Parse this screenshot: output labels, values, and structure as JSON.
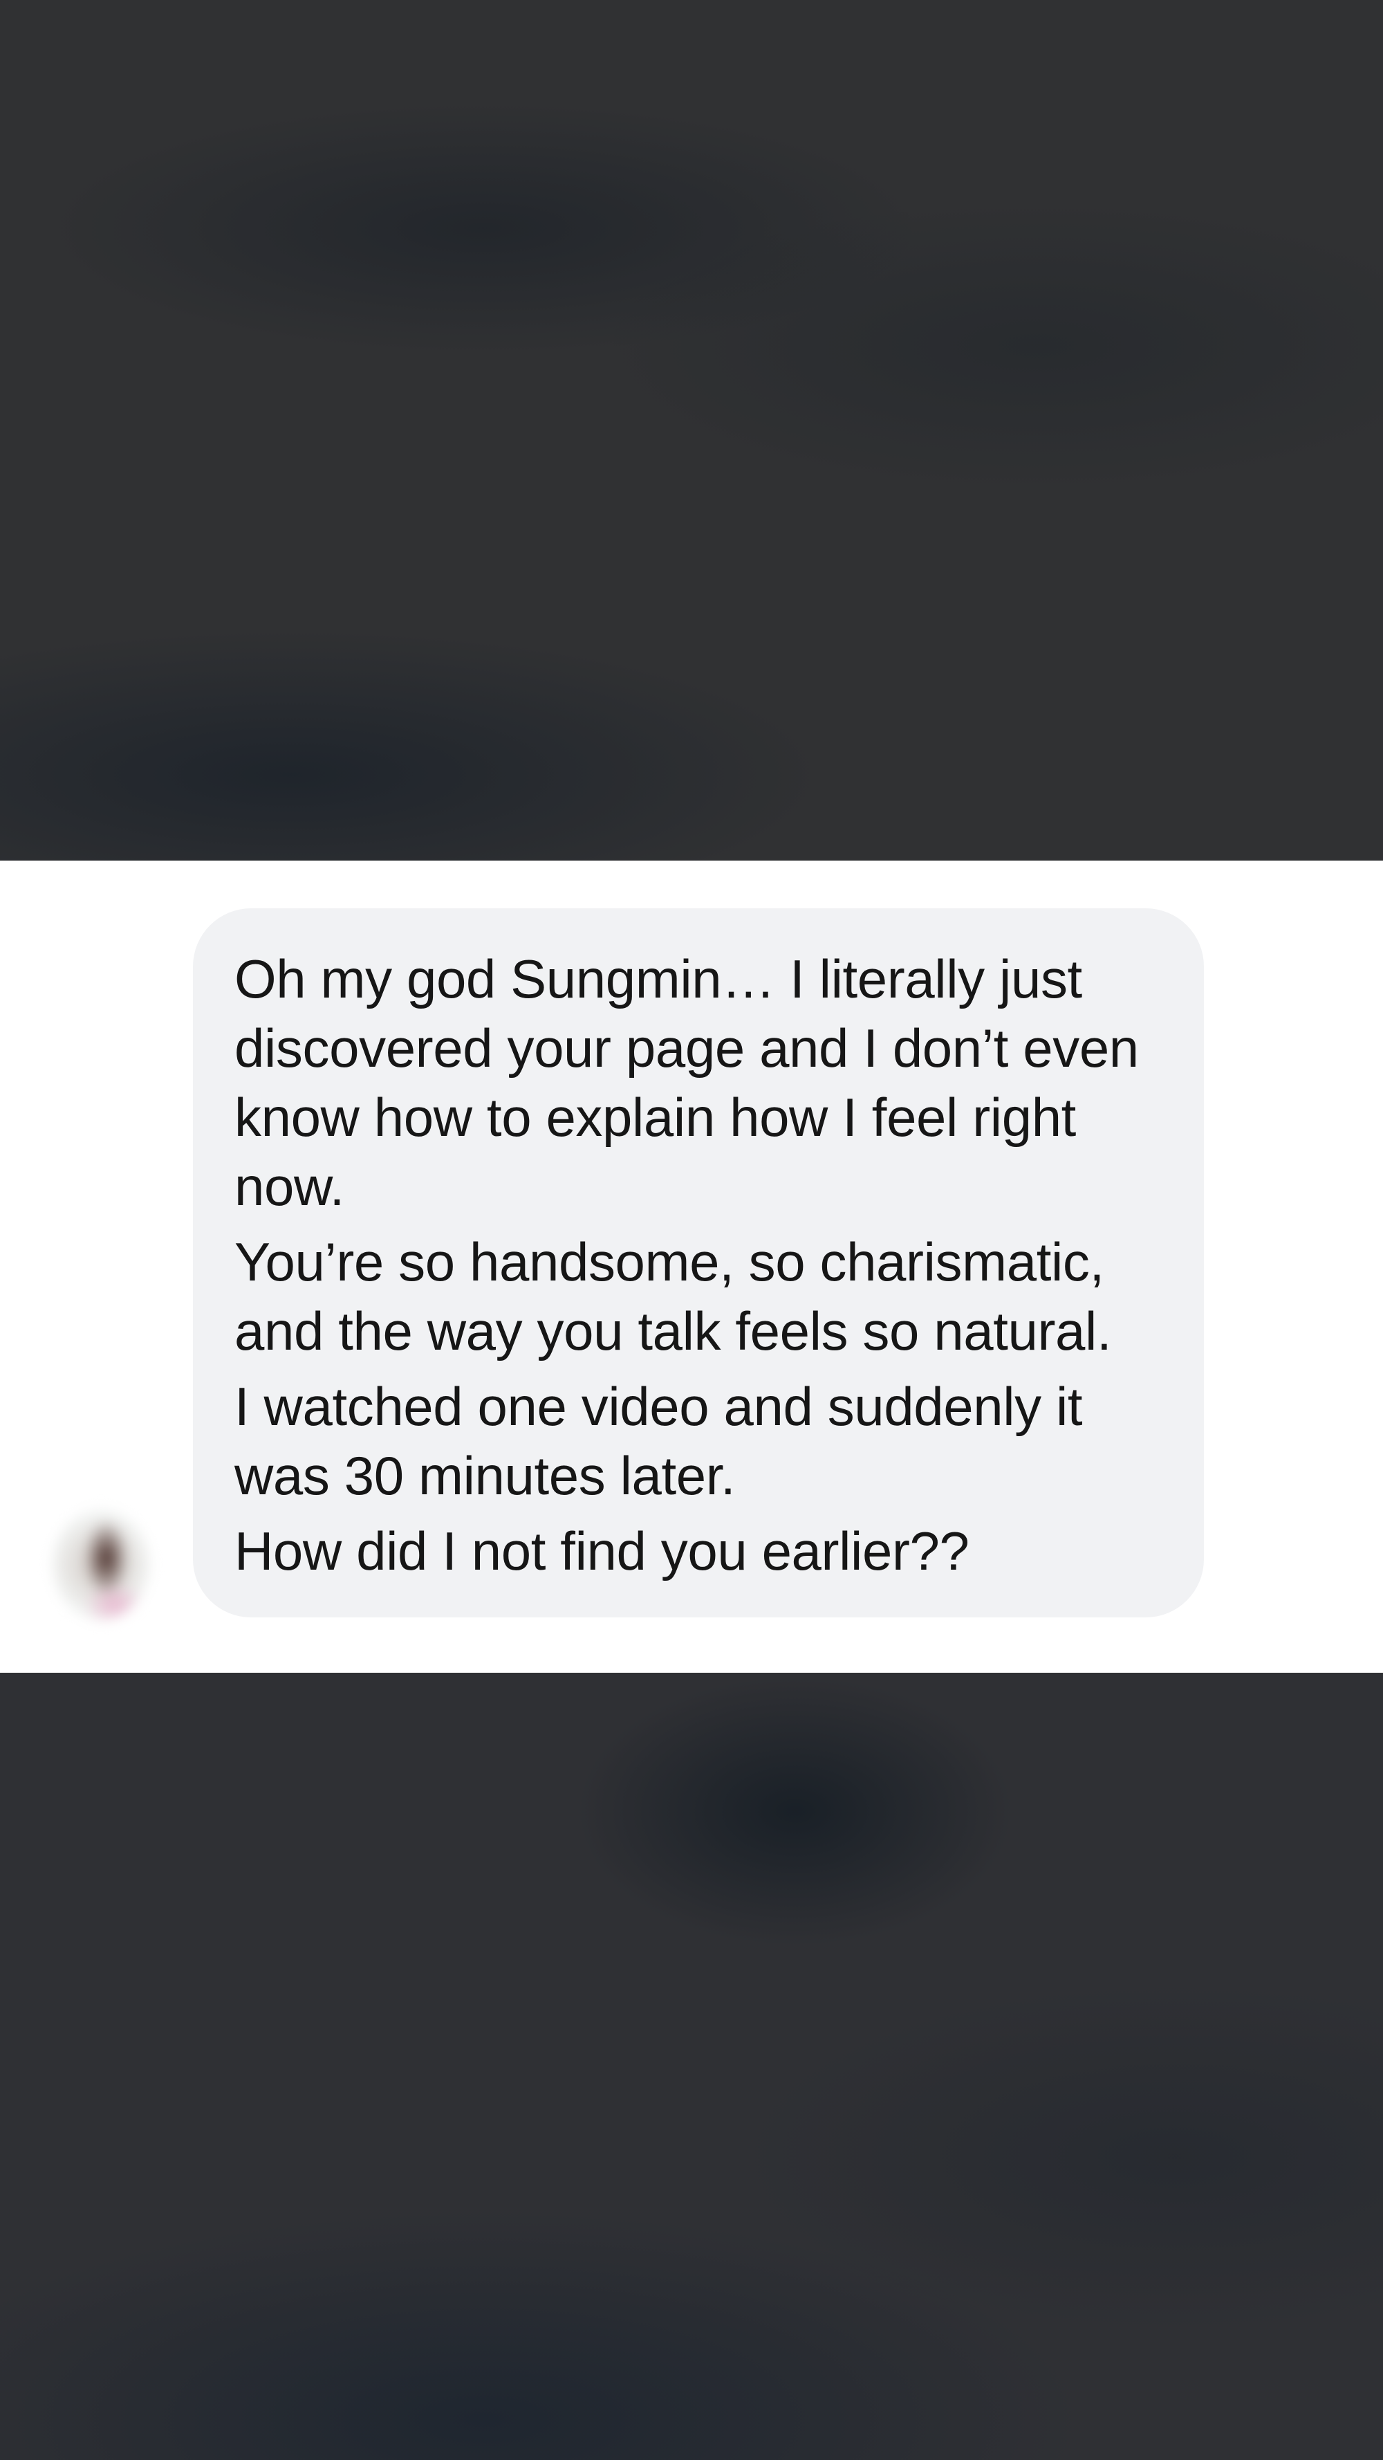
{
  "message": {
    "paragraphs": [
      "Oh my god Sungmin… I literally just discovered your page and I don’t even know how to explain how I feel right now.",
      "You’re so handsome, so charismatic, and the way you talk feels so natural.",
      "I watched one video and suddenly it was 30 minutes later.",
      "How did I not find you earlier??"
    ]
  },
  "sender": {
    "avatar": "blurred-profile-photo"
  },
  "colors": {
    "bubble": "#f1f2f4",
    "strip": "#ffffff",
    "background": "#2f3033",
    "text": "#161616"
  }
}
